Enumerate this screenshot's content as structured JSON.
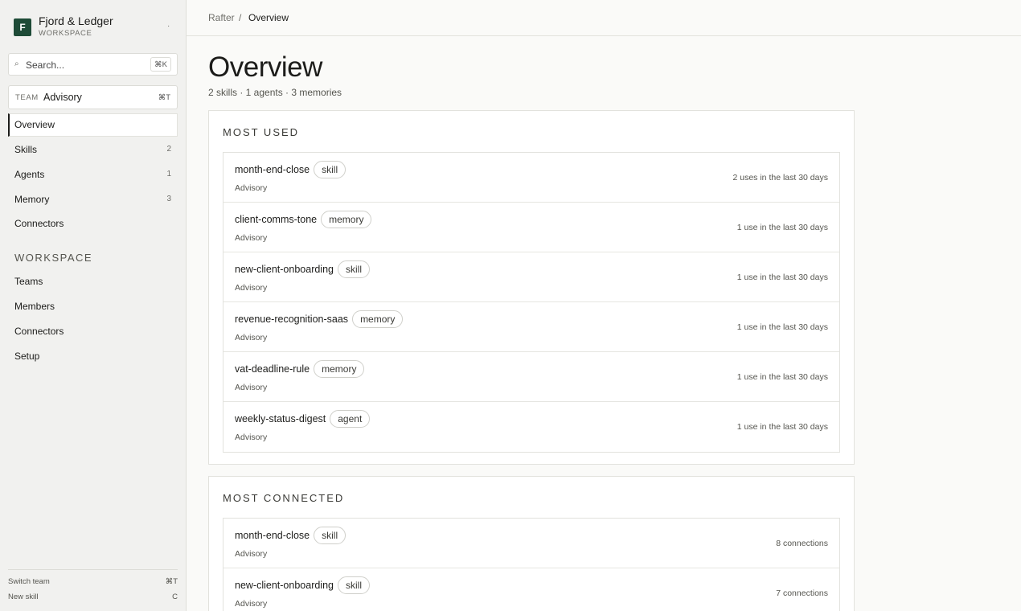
{
  "workspace": {
    "logo_letter": "F",
    "name": "Fjord & Ledger",
    "subtitle": "WORKSPACE",
    "menu_glyph": "·"
  },
  "search": {
    "icon": "⌕",
    "placeholder": "Search...",
    "shortcut": "⌘K"
  },
  "team": {
    "tag": "TEAM",
    "name": "Advisory",
    "shortcut": "⌘T"
  },
  "nav": [
    {
      "label": "Overview",
      "count": ""
    },
    {
      "label": "Skills",
      "count": "2"
    },
    {
      "label": "Agents",
      "count": "1"
    },
    {
      "label": "Memory",
      "count": "3"
    },
    {
      "label": "Connectors",
      "count": ""
    }
  ],
  "workspace_section": {
    "label": "WORKSPACE",
    "items": [
      "Teams",
      "Members",
      "Connectors",
      "Setup"
    ]
  },
  "footer": [
    {
      "label": "Switch team",
      "shortcut": "⌘T"
    },
    {
      "label": "New skill",
      "shortcut": "C"
    }
  ],
  "breadcrumb": {
    "root": "Rafter",
    "sep": "/",
    "current": "Overview"
  },
  "page": {
    "title": "Overview",
    "stats": "2 skills · 1 agents · 3 memories"
  },
  "most_used": {
    "title": "MOST USED",
    "rows": [
      {
        "name": "month-end-close",
        "type": "skill",
        "team": "Advisory",
        "metric": "2 uses in the last 30 days"
      },
      {
        "name": "client-comms-tone",
        "type": "memory",
        "team": "Advisory",
        "metric": "1 use in the last 30 days"
      },
      {
        "name": "new-client-onboarding",
        "type": "skill",
        "team": "Advisory",
        "metric": "1 use in the last 30 days"
      },
      {
        "name": "revenue-recognition-saas",
        "type": "memory",
        "team": "Advisory",
        "metric": "1 use in the last 30 days"
      },
      {
        "name": "vat-deadline-rule",
        "type": "memory",
        "team": "Advisory",
        "metric": "1 use in the last 30 days"
      },
      {
        "name": "weekly-status-digest",
        "type": "agent",
        "team": "Advisory",
        "metric": "1 use in the last 30 days"
      }
    ]
  },
  "most_connected": {
    "title": "MOST CONNECTED",
    "rows": [
      {
        "name": "month-end-close",
        "type": "skill",
        "team": "Advisory",
        "metric": "8 connections"
      },
      {
        "name": "new-client-onboarding",
        "type": "skill",
        "team": "Advisory",
        "metric": "7 connections"
      }
    ]
  }
}
